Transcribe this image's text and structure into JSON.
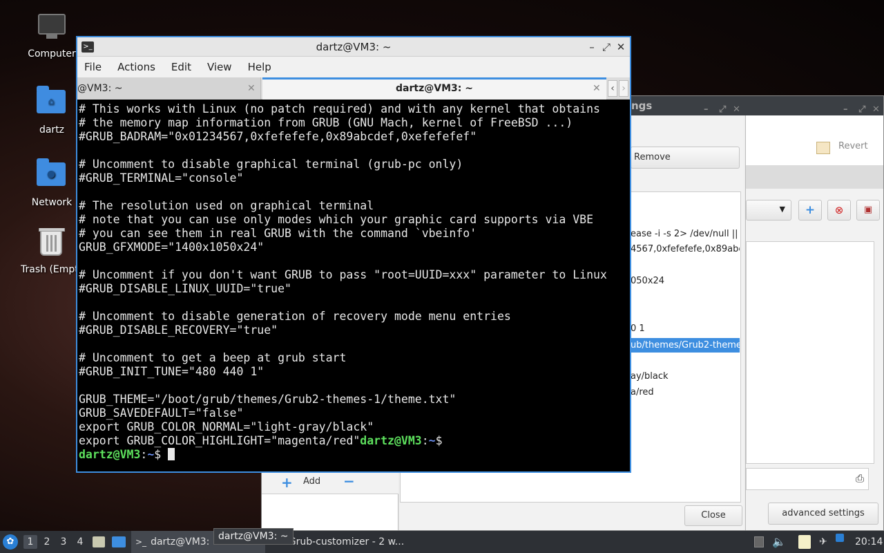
{
  "desktop": {
    "icons": [
      {
        "label": "Computer"
      },
      {
        "label": "dartz"
      },
      {
        "label": "Network"
      },
      {
        "label": "Trash (Empt"
      }
    ]
  },
  "grub_window": {
    "title_fragment": "ngs",
    "remove_label": "Remove",
    "revert_label": "Revert",
    "add_label": "Add",
    "close_label": "Close",
    "advanced_label": "advanced settings",
    "entry_lines": [
      "ease -i -s 2> /dev/null ||",
      "4567,0xfefefefe,0x89abc",
      "050x24",
      "0 1",
      "ub/themes/Grub2-theme",
      "ay/black",
      "a/red"
    ]
  },
  "terminal": {
    "window_title": "dartz@VM3: ~",
    "menu": [
      "File",
      "Actions",
      "Edit",
      "View",
      "Help"
    ],
    "tab_inactive_label": "@VM3: ~",
    "tab_active_label": "dartz@VM3: ~",
    "lines": [
      "# This works with Linux (no patch required) and with any kernel that obtains",
      "# the memory map information from GRUB (GNU Mach, kernel of FreeBSD ...)",
      "#GRUB_BADRAM=\"0x01234567,0xfefefefe,0x89abcdef,0xefefefef\"",
      "",
      "# Uncomment to disable graphical terminal (grub-pc only)",
      "#GRUB_TERMINAL=\"console\"",
      "",
      "# The resolution used on graphical terminal",
      "# note that you can use only modes which your graphic card supports via VBE",
      "# you can see them in real GRUB with the command `vbeinfo'",
      "GRUB_GFXMODE=\"1400x1050x24\"",
      "",
      "# Uncomment if you don't want GRUB to pass \"root=UUID=xxx\" parameter to Linux",
      "#GRUB_DISABLE_LINUX_UUID=\"true\"",
      "",
      "# Uncomment to disable generation of recovery mode menu entries",
      "#GRUB_DISABLE_RECOVERY=\"true\"",
      "",
      "# Uncomment to get a beep at grub start",
      "#GRUB_INIT_TUNE=\"480 440 1\"",
      "",
      "GRUB_THEME=\"/boot/grub/themes/Grub2-themes-1/theme.txt\"",
      "GRUB_SAVEDEFAULT=\"false\"",
      "export GRUB_COLOR_NORMAL=\"light-gray/black\""
    ],
    "last_output": "export GRUB_COLOR_HIGHLIGHT=\"magenta/red\"",
    "prompt_user": "dartz@VM3",
    "prompt_colon": ":",
    "prompt_path": "~",
    "prompt_symbol": "$"
  },
  "taskbar": {
    "workspaces": [
      "1",
      "2",
      "3",
      "4"
    ],
    "active_workspace": "1",
    "task_terminal": "dartz@VM3: ~",
    "task_grub": "Grub-customizer - 2 w...",
    "tooltip": "dartz@VM3: ~",
    "clock": "20:14"
  },
  "colors": {
    "accent": "#3d8ee0",
    "prompt_user": "#5de05d",
    "prompt_path": "#6a8ef0",
    "taskbar": "#2d3035"
  }
}
